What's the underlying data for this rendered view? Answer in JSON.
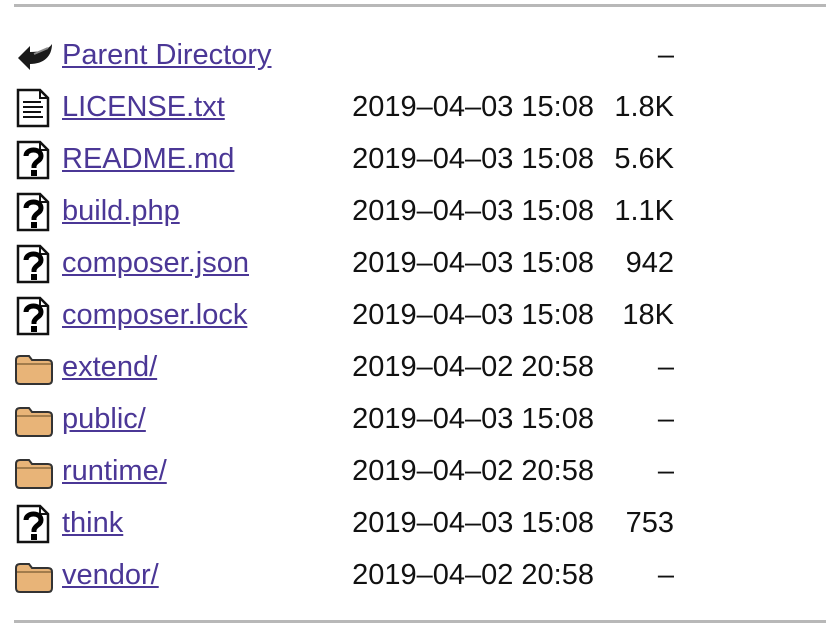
{
  "listing": {
    "parent": {
      "name": "Parent Directory",
      "size": "–",
      "icon": "back-icon"
    },
    "entries": [
      {
        "name": "LICENSE.txt",
        "date": "2019–04–03 15:08",
        "size": "1.8K",
        "icon": "text-file-icon"
      },
      {
        "name": "README.md",
        "date": "2019–04–03 15:08",
        "size": "5.6K",
        "icon": "unknown-file-icon"
      },
      {
        "name": "build.php",
        "date": "2019–04–03 15:08",
        "size": "1.1K",
        "icon": "unknown-file-icon"
      },
      {
        "name": "composer.json",
        "date": "2019–04–03 15:08",
        "size": "942",
        "icon": "unknown-file-icon"
      },
      {
        "name": "composer.lock",
        "date": "2019–04–03 15:08",
        "size": "18K",
        "icon": "unknown-file-icon"
      },
      {
        "name": "extend/",
        "date": "2019–04–02 20:58",
        "size": "–",
        "icon": "folder-icon"
      },
      {
        "name": "public/",
        "date": "2019–04–03 15:08",
        "size": "–",
        "icon": "folder-icon"
      },
      {
        "name": "runtime/",
        "date": "2019–04–02 20:58",
        "size": "–",
        "icon": "folder-icon"
      },
      {
        "name": "think",
        "date": "2019–04–03 15:08",
        "size": "753",
        "icon": "unknown-file-icon"
      },
      {
        "name": "vendor/",
        "date": "2019–04–02 20:58",
        "size": "–",
        "icon": "folder-icon"
      }
    ]
  },
  "colors": {
    "link": "#4b3796",
    "folder": "#e8b478",
    "rule": "#b8b8b8"
  }
}
